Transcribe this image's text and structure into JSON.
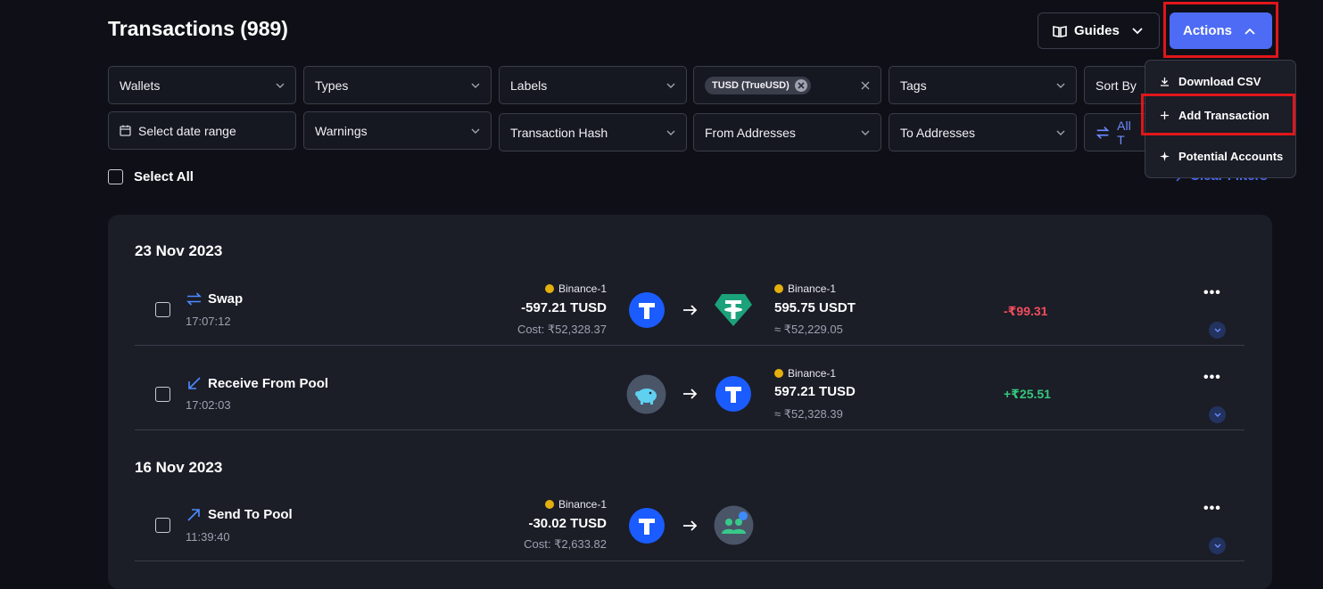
{
  "header": {
    "title": "Transactions (989)",
    "guides_label": "Guides",
    "actions_label": "Actions"
  },
  "filters": {
    "wallets": "Wallets",
    "types": "Types",
    "labels": "Labels",
    "asset_chip": "TUSD (TrueUSD)",
    "tags": "Tags",
    "sort_by": "Sort By",
    "date_range": "Select date range",
    "warnings": "Warnings",
    "tx_hash": "Transaction Hash",
    "from_addresses": "From Addresses",
    "to_addresses": "To Addresses",
    "all_toggle": "All T",
    "clear_filters": "Clear Filters",
    "select_all": "Select All"
  },
  "menu": {
    "download_csv": "Download CSV",
    "add_transaction": "Add Transaction",
    "potential_accounts": "Potential Accounts"
  },
  "groups": [
    {
      "date": "23 Nov 2023",
      "rows": [
        {
          "type": "Swap",
          "time": "17:07:12",
          "out_wallet": "Binance-1",
          "out_amount": "-597.21 TUSD",
          "out_cost": "Cost: ₹52,328.37",
          "in_wallet": "Binance-1",
          "in_amount": "595.75 USDT",
          "in_value": "≈ ₹52,229.05",
          "pnl": "-₹99.31"
        },
        {
          "type": "Receive From Pool",
          "time": "17:02:03",
          "in_wallet": "Binance-1",
          "in_amount": "597.21 TUSD",
          "in_value": "≈ ₹52,328.39",
          "pnl": "+₹25.51"
        }
      ]
    },
    {
      "date": "16 Nov 2023",
      "rows": [
        {
          "type": "Send To Pool",
          "time": "11:39:40",
          "out_wallet": "Binance-1",
          "out_amount": "-30.02 TUSD",
          "out_cost": "Cost: ₹2,633.82"
        }
      ]
    }
  ],
  "colors": {
    "accent": "#4d6bf5",
    "highlight": "#e0161b",
    "negative": "#f34d5d",
    "positive": "#34c77b",
    "tusd": "#1a5cff",
    "usdt": "#1ba27a"
  }
}
